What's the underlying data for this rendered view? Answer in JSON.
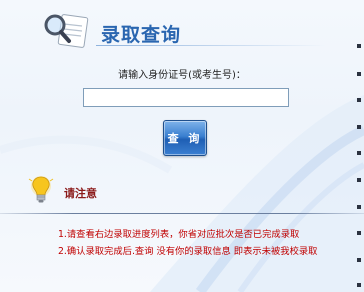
{
  "header": {
    "title": "录取查询",
    "icon": "magnifier-document-icon"
  },
  "form": {
    "label": "请输入身份证号(或考生号)：",
    "input_value": "",
    "input_placeholder": "",
    "button_label": "查 询"
  },
  "notice": {
    "icon": "lightbulb-icon",
    "title": "请注意",
    "items": [
      "1.请查看右边录取进度列表，你省对应批次是否已完成录取",
      "2.确认录取完成后.查询 没有你的录取信息 即表示未被我校录取"
    ]
  },
  "colors": {
    "title": "#2a66b0",
    "notice_title": "#8b1a1a",
    "notice_text": "#c00000",
    "button": "#2f72c8"
  }
}
